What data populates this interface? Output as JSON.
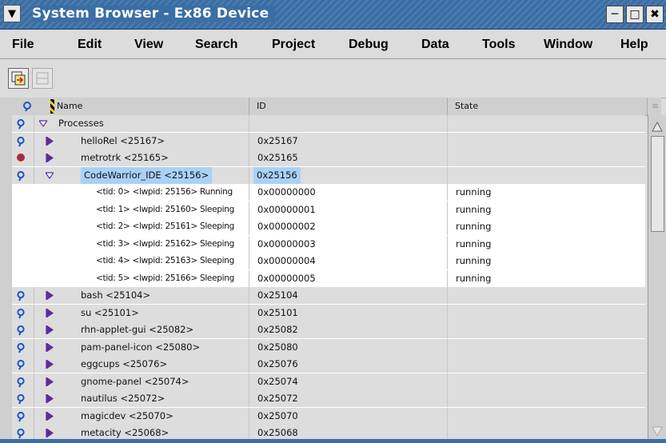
{
  "window": {
    "title": "System Browser - Ex86 Device",
    "menu_icon": "chevron-down-icon",
    "controls": [
      "minimize-icon",
      "maximize-icon",
      "close-icon"
    ]
  },
  "menubar": [
    "File",
    "Edit",
    "View",
    "Search",
    "Project",
    "Debug",
    "Data",
    "Tools",
    "Window",
    "Help"
  ],
  "toolbar": {
    "buttons": [
      {
        "icon": "attach-process-icon",
        "enabled": true
      },
      {
        "icon": "window-panel-icon",
        "enabled": false
      }
    ]
  },
  "columns": {
    "name": "Name",
    "id": "ID",
    "state": "State"
  },
  "rows": [
    {
      "name": "Processes",
      "id": "",
      "state": "",
      "level": 0,
      "expanded": true,
      "icon": "process-blue-icon"
    },
    {
      "name": "helloRel <25167>",
      "id": "0x25167",
      "state": "",
      "level": 1,
      "expanded": false,
      "icon": "process-blue-icon"
    },
    {
      "name": "metrotrk <25165>",
      "id": "0x25165",
      "state": "",
      "level": 1,
      "expanded": false,
      "icon": "process-red-icon"
    },
    {
      "name": "CodeWarrior_IDE <25156>",
      "id": "0x25156",
      "state": "",
      "level": 1,
      "expanded": true,
      "icon": "process-blue-icon",
      "selected": true
    },
    {
      "name": "<tid: 0>  <lwpid: 25156> Running",
      "id": "0x00000000",
      "state": "running",
      "level": 2
    },
    {
      "name": "<tid: 1>  <lwpid: 25160> Sleeping",
      "id": "0x00000001",
      "state": "running",
      "level": 2
    },
    {
      "name": "<tid: 2>  <lwpid: 25161> Sleeping",
      "id": "0x00000002",
      "state": "running",
      "level": 2
    },
    {
      "name": "<tid: 3>  <lwpid: 25162> Sleeping",
      "id": "0x00000003",
      "state": "running",
      "level": 2
    },
    {
      "name": "<tid: 4>  <lwpid: 25163> Sleeping",
      "id": "0x00000004",
      "state": "running",
      "level": 2
    },
    {
      "name": "<tid: 5>  <lwpid: 25166> Sleeping",
      "id": "0x00000005",
      "state": "running",
      "level": 2
    },
    {
      "name": "bash <25104>",
      "id": "0x25104",
      "state": "",
      "level": 1,
      "expanded": false,
      "icon": "process-blue-icon"
    },
    {
      "name": "su <25101>",
      "id": "0x25101",
      "state": "",
      "level": 1,
      "expanded": false,
      "icon": "process-blue-icon"
    },
    {
      "name": "rhn-applet-gui <25082>",
      "id": "0x25082",
      "state": "",
      "level": 1,
      "expanded": false,
      "icon": "process-blue-icon"
    },
    {
      "name": "pam-panel-icon <25080>",
      "id": "0x25080",
      "state": "",
      "level": 1,
      "expanded": false,
      "icon": "process-blue-icon"
    },
    {
      "name": "eggcups <25076>",
      "id": "0x25076",
      "state": "",
      "level": 1,
      "expanded": false,
      "icon": "process-blue-icon"
    },
    {
      "name": "gnome-panel <25074>",
      "id": "0x25074",
      "state": "",
      "level": 1,
      "expanded": false,
      "icon": "process-blue-icon"
    },
    {
      "name": "nautilus <25072>",
      "id": "0x25072",
      "state": "",
      "level": 1,
      "expanded": false,
      "icon": "process-blue-icon"
    },
    {
      "name": "magicdev <25070>",
      "id": "0x25070",
      "state": "",
      "level": 1,
      "expanded": false,
      "icon": "process-blue-icon"
    },
    {
      "name": "metacity <25068>",
      "id": "0x25068",
      "state": "",
      "level": 1,
      "expanded": false,
      "icon": "process-blue-icon"
    }
  ],
  "colors": {
    "titlebar": "#3a6ea5",
    "selection": "#a9d1f7",
    "process_icon": "#1b55c9",
    "process_icon_alert": "#d02020",
    "expander": "#5a2ca0"
  }
}
